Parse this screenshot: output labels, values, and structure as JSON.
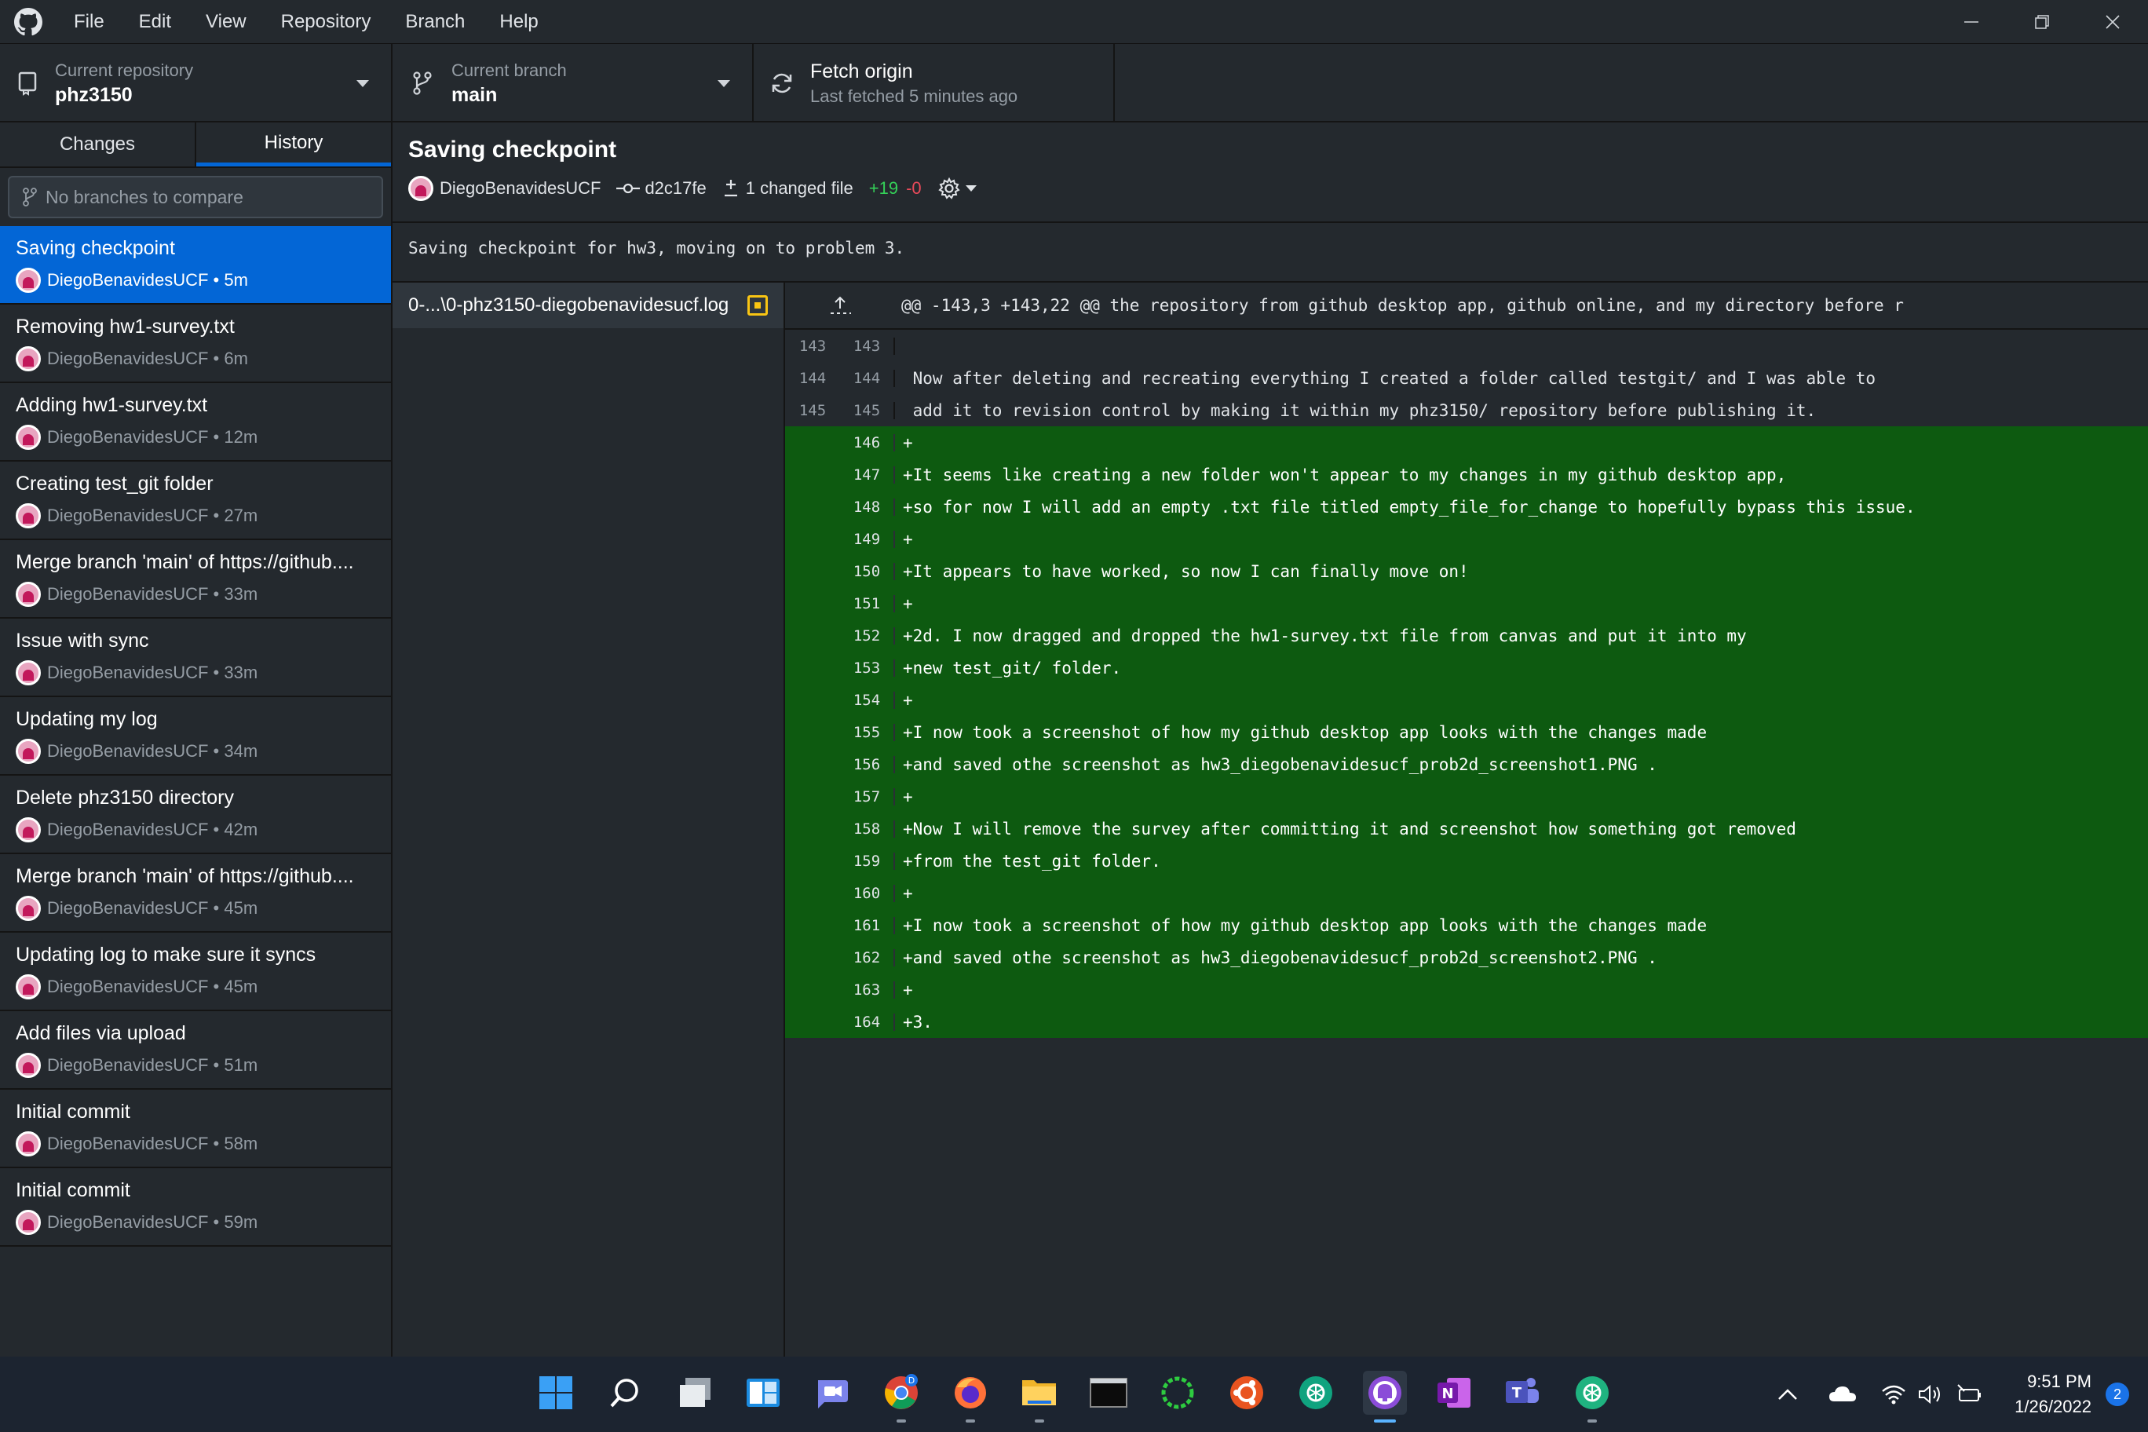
{
  "menu": [
    "File",
    "Edit",
    "View",
    "Repository",
    "Branch",
    "Help"
  ],
  "toolbar": {
    "repo_label": "Current repository",
    "repo_value": "phz3150",
    "branch_label": "Current branch",
    "branch_value": "main",
    "fetch_label": "Fetch origin",
    "fetch_sub": "Last fetched 5 minutes ago"
  },
  "sidebar": {
    "tabs": [
      "Changes",
      "History"
    ],
    "compare_placeholder": "No branches to compare",
    "commits": [
      {
        "title": "Saving checkpoint",
        "meta": "DiegoBenavidesUCF • 5m",
        "selected": true
      },
      {
        "title": "Removing hw1-survey.txt",
        "meta": "DiegoBenavidesUCF • 6m"
      },
      {
        "title": "Adding hw1-survey.txt",
        "meta": "DiegoBenavidesUCF • 12m"
      },
      {
        "title": "Creating test_git folder",
        "meta": "DiegoBenavidesUCF • 27m"
      },
      {
        "title": "Merge branch 'main' of https://github....",
        "meta": "DiegoBenavidesUCF • 33m"
      },
      {
        "title": "Issue with sync",
        "meta": "DiegoBenavidesUCF • 33m"
      },
      {
        "title": "Updating my log",
        "meta": "DiegoBenavidesUCF • 34m"
      },
      {
        "title": "Delete phz3150 directory",
        "meta": "DiegoBenavidesUCF • 42m"
      },
      {
        "title": "Merge branch 'main' of https://github....",
        "meta": "DiegoBenavidesUCF • 45m"
      },
      {
        "title": "Updating log to make sure it syncs",
        "meta": "DiegoBenavidesUCF • 45m"
      },
      {
        "title": "Add files via upload",
        "meta": "DiegoBenavidesUCF • 51m"
      },
      {
        "title": "Initial commit",
        "meta": "DiegoBenavidesUCF • 58m"
      },
      {
        "title": "Initial commit",
        "meta": "DiegoBenavidesUCF • 59m"
      }
    ]
  },
  "commit": {
    "summary": "Saving checkpoint",
    "author": "DiegoBenavidesUCF",
    "sha": "d2c17fe",
    "changed_files": "1 changed file",
    "additions": "+19",
    "deletions": "-0",
    "description": "Saving checkpoint for hw3, moving on to problem 3."
  },
  "files": [
    {
      "name": "0-...\\0-phz3150-diegobenavidesucf.log",
      "status": "modified"
    }
  ],
  "diff": {
    "hunk_header": "@@ -143,3 +143,22 @@ the repository from github desktop app, github online, and my directory before r",
    "lines": [
      {
        "old": "143",
        "new": "143",
        "type": "ctx",
        "text": ""
      },
      {
        "old": "144",
        "new": "144",
        "type": "ctx",
        "text": " Now after deleting and recreating everything I created a folder called testgit/ and I was able to"
      },
      {
        "old": "145",
        "new": "145",
        "type": "ctx",
        "text": " add it to revision control by making it within my phz3150/ repository before publishing it."
      },
      {
        "old": "",
        "new": "146",
        "type": "added",
        "text": "+"
      },
      {
        "old": "",
        "new": "147",
        "type": "added",
        "text": "+It seems like creating a new folder won't appear to my changes in my github desktop app,"
      },
      {
        "old": "",
        "new": "148",
        "type": "added",
        "text": "+so for now I will add an empty .txt file titled empty_file_for_change to hopefully bypass this issue."
      },
      {
        "old": "",
        "new": "149",
        "type": "added",
        "text": "+"
      },
      {
        "old": "",
        "new": "150",
        "type": "added",
        "text": "+It appears to have worked, so now I can finally move on!"
      },
      {
        "old": "",
        "new": "151",
        "type": "added",
        "text": "+"
      },
      {
        "old": "",
        "new": "152",
        "type": "added",
        "text": "+2d. I now dragged and dropped the hw1-survey.txt file from canvas and put it into my"
      },
      {
        "old": "",
        "new": "153",
        "type": "added",
        "text": "+new test_git/ folder."
      },
      {
        "old": "",
        "new": "154",
        "type": "added",
        "text": "+"
      },
      {
        "old": "",
        "new": "155",
        "type": "added",
        "text": "+I now took a screenshot of how my github desktop app looks with the changes made"
      },
      {
        "old": "",
        "new": "156",
        "type": "added",
        "text": "+and saved othe screenshot as hw3_diegobenavidesucf_prob2d_screenshot1.PNG ."
      },
      {
        "old": "",
        "new": "157",
        "type": "added",
        "text": "+"
      },
      {
        "old": "",
        "new": "158",
        "type": "added",
        "text": "+Now I will remove the survey after committing it and screenshot how something got removed"
      },
      {
        "old": "",
        "new": "159",
        "type": "added",
        "text": "+from the test_git folder."
      },
      {
        "old": "",
        "new": "160",
        "type": "added",
        "text": "+"
      },
      {
        "old": "",
        "new": "161",
        "type": "added",
        "text": "+I now took a screenshot of how my github desktop app looks with the changes made"
      },
      {
        "old": "",
        "new": "162",
        "type": "added",
        "text": "+and saved othe screenshot as hw3_diegobenavidesucf_prob2d_screenshot2.PNG ."
      },
      {
        "old": "",
        "new": "163",
        "type": "added",
        "text": "+"
      },
      {
        "old": "",
        "new": "164",
        "type": "added",
        "text": "+3."
      }
    ]
  },
  "taskbar": {
    "apps": [
      "windows-start",
      "search",
      "task-view",
      "widgets",
      "chat",
      "chrome",
      "firefox",
      "file-explorer",
      "terminal",
      "app-green-ring",
      "ubuntu",
      "chatgpt",
      "github-desktop",
      "onenote",
      "teams",
      "chatgpt-2"
    ],
    "clock_time": "9:51 PM",
    "clock_date": "1/26/2022",
    "notifications": "2"
  },
  "colors": {
    "accent": "#0366d6",
    "added_bg": "#0d5a10",
    "additions": "#34d058",
    "deletions": "#ea4a5a",
    "modified": "#f9c513"
  }
}
